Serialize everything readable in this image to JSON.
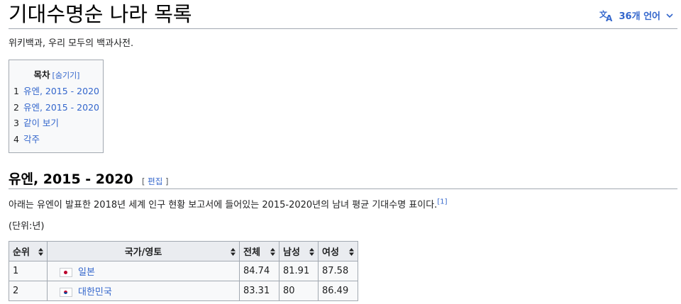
{
  "page": {
    "title": "기대수명순 나라 목록",
    "languages_label": "36개 언어",
    "tagline": "위키백과, 우리 모두의 백과사전."
  },
  "toc": {
    "heading": "목차",
    "toggle": "[숨기기]",
    "items": [
      {
        "num": "1",
        "label": "유엔, 2015 - 2020"
      },
      {
        "num": "2",
        "label": "유엔, 2015 - 2020"
      },
      {
        "num": "3",
        "label": "같이 보기"
      },
      {
        "num": "4",
        "label": "각주"
      }
    ]
  },
  "section": {
    "heading": "유엔, 2015 - 2020",
    "edit_open": "[ ",
    "edit_label": "편집",
    "edit_close": " ]",
    "paragraph": "아래는 유엔이 발표한 2018년 세계 인구 현황 보고서에 들어있는 2015-2020년의 남녀 평균 기대수명 표이다.",
    "footnote": "[1]",
    "unit": "(단위:년)"
  },
  "table": {
    "headers": [
      "순위",
      "국가/영토",
      "전체",
      "남성",
      "여성"
    ],
    "rows": [
      {
        "rank": "1",
        "country": "일본",
        "flag": "japan-flag",
        "total": "84.74",
        "male": "81.91",
        "female": "87.58"
      },
      {
        "rank": "2",
        "country": "대한민국",
        "flag": "south-korea-flag",
        "total": "83.31",
        "male": "80",
        "female": "86.49"
      }
    ]
  },
  "colors": {
    "link": "#3366cc",
    "border": "#a2a9b1",
    "header_bg": "#eaecf0",
    "flag_red": "#bc002d",
    "flag_blue": "#0047a0"
  }
}
